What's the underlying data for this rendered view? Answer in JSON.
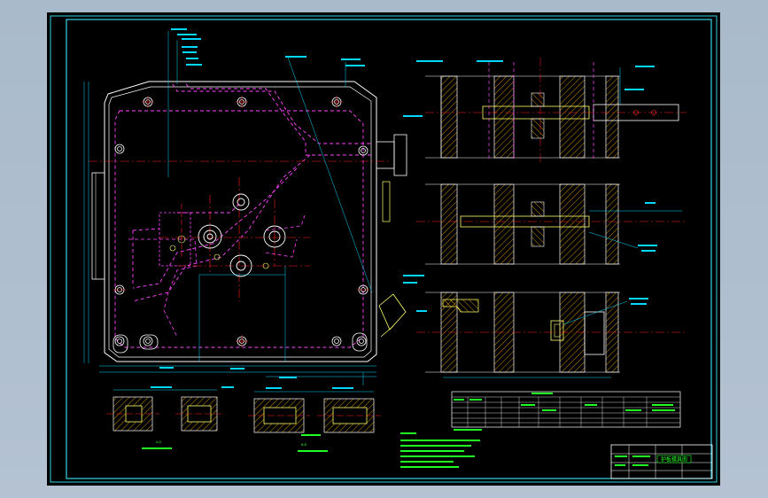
{
  "colors": {
    "background": "#000000",
    "frame": "#36d1e6",
    "outline": "#ffffff",
    "hidden": "#ff44ff",
    "center": "#ff2222",
    "dimension": "#00d8ff",
    "hatch": "#ffb000",
    "bolt": "#ffff66",
    "notes": "#22ff22"
  },
  "sheet": {
    "title_block_caption": "护板模具图"
  },
  "notes": {
    "section_a_caption": "A-A",
    "section_b_caption": "B-B"
  }
}
